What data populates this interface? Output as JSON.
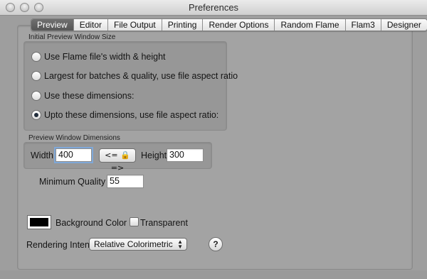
{
  "window": {
    "title": "Preferences"
  },
  "tabs": [
    {
      "label": "Preview",
      "active": true
    },
    {
      "label": "Editor",
      "active": false
    },
    {
      "label": "File Output",
      "active": false
    },
    {
      "label": "Printing",
      "active": false
    },
    {
      "label": "Render Options",
      "active": false
    },
    {
      "label": "Random Flame",
      "active": false
    },
    {
      "label": "Flam3",
      "active": false
    },
    {
      "label": "Designer",
      "active": false
    }
  ],
  "initial_size": {
    "group_label": "Initial Preview Window Size",
    "options": [
      {
        "label": "Use Flame file's width & height",
        "checked": false
      },
      {
        "label": "Largest for batches & quality, use file aspect ratio",
        "checked": false
      },
      {
        "label": "Use these dimensions:",
        "checked": false
      },
      {
        "label": "Upto these dimensions, use file aspect ratio:",
        "checked": true
      }
    ]
  },
  "dimensions": {
    "group_label": "Preview Window Dimensions",
    "width_label": "Width",
    "width_value": "400",
    "link_button": "<= 🔒 =>",
    "height_label": "Height",
    "height_value": "300"
  },
  "quality": {
    "label": "Minimum Quality",
    "value": "55"
  },
  "background": {
    "label": "Background Color",
    "color": "#000000",
    "transparent_label": "Transparent",
    "transparent_checked": false
  },
  "rendering_intent": {
    "label": "Rendering Intent",
    "value": "Relative Colorimetric",
    "help": "?"
  }
}
